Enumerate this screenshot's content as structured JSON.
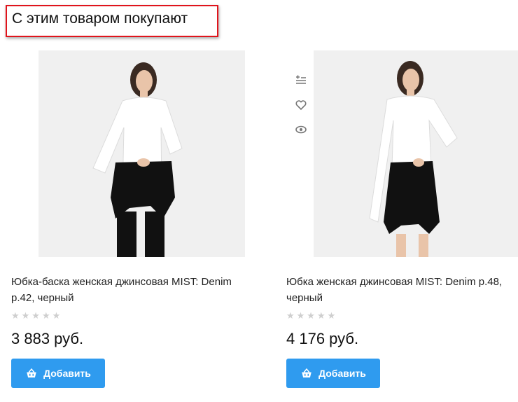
{
  "section": {
    "title": "С этим товаром покупают"
  },
  "products": [
    {
      "title": "Юбка-баска женская джинсовая MIST: Denim р.42, черный",
      "rating_stars": "★★★★★",
      "price": "3 883 руб.",
      "add_label": "Добавить",
      "image_icon": "model-photo"
    },
    {
      "title": "Юбка женская джинсовая MIST: Denim р.48, черный",
      "rating_stars": "★★★★★",
      "price": "4 176 руб.",
      "add_label": "Добавить",
      "image_icon": "model-photo"
    }
  ],
  "side_icons": [
    "compare-icon",
    "heart-icon",
    "eye-icon"
  ],
  "colors": {
    "accent": "#2f9bef",
    "highlight_border": "#e0141c",
    "star_empty": "#cfcfcf"
  }
}
